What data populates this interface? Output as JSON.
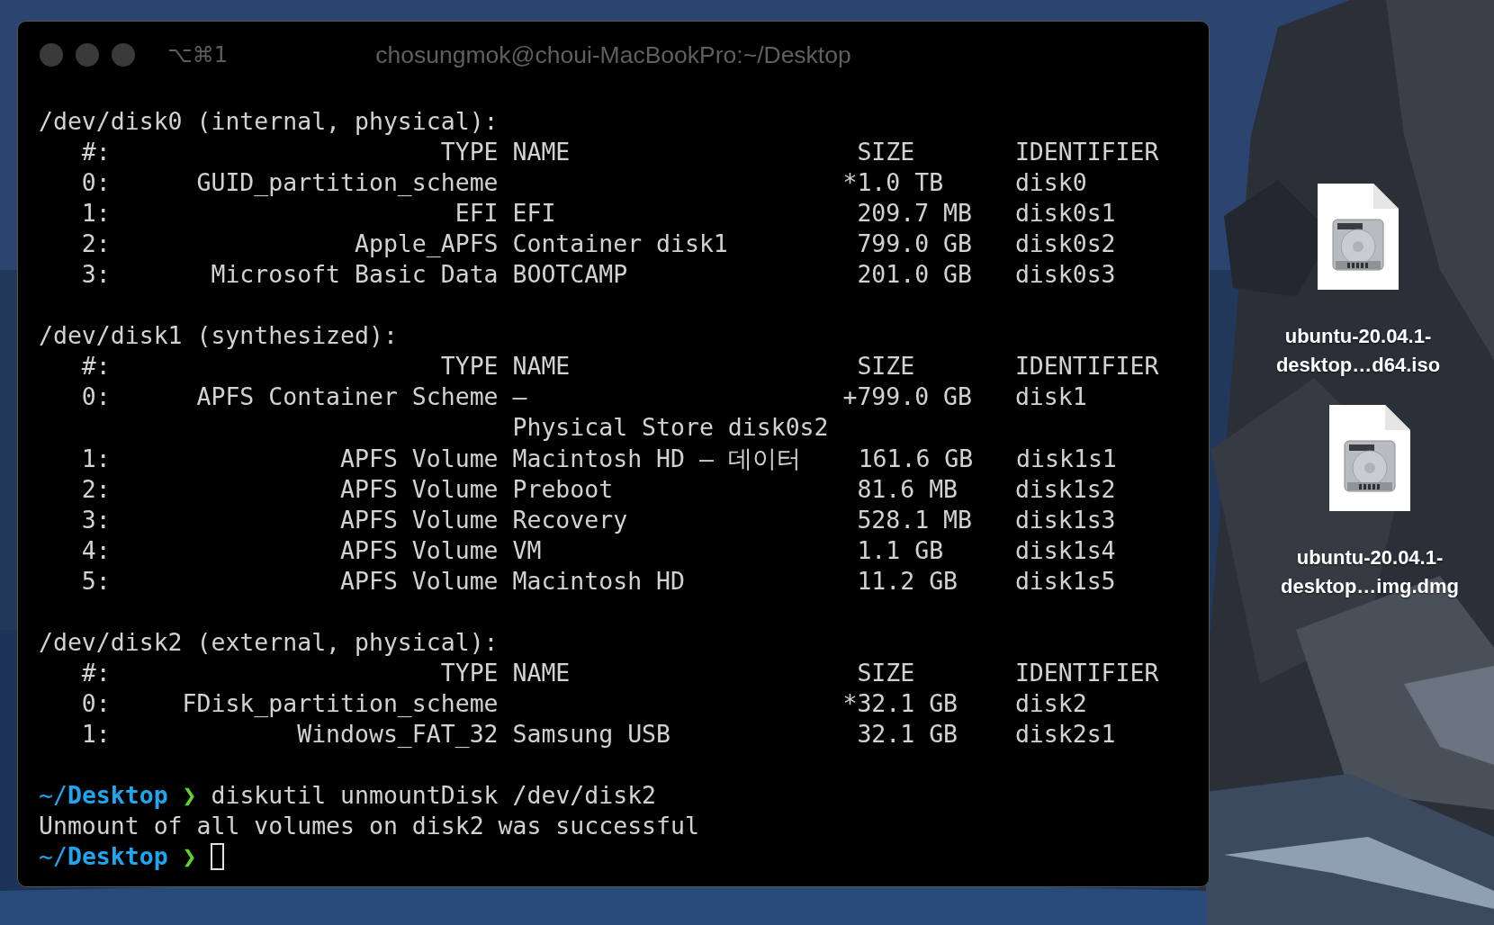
{
  "window": {
    "shortcut": "⌥⌘1",
    "title": "chosungmok@choui-MacBookPro:~/Desktop"
  },
  "terminal": {
    "sections": [
      {
        "lines": [
          {
            "kind": "output",
            "text": "/dev/disk0 (internal, physical):"
          },
          {
            "kind": "output",
            "text": "   #:                       TYPE NAME                    SIZE       IDENTIFIER"
          },
          {
            "kind": "output",
            "text": "   0:      GUID_partition_scheme                        *1.0 TB     disk0"
          },
          {
            "kind": "output",
            "text": "   1:                        EFI EFI                     209.7 MB   disk0s1"
          },
          {
            "kind": "output",
            "text": "   2:                 Apple_APFS Container disk1         799.0 GB   disk0s2"
          },
          {
            "kind": "output",
            "text": "   3:       Microsoft Basic Data BOOTCAMP                201.0 GB   disk0s3"
          }
        ]
      },
      {
        "lines": [
          {
            "kind": "output",
            "text": "/dev/disk1 (synthesized):"
          },
          {
            "kind": "output",
            "text": "   #:                       TYPE NAME                    SIZE       IDENTIFIER"
          },
          {
            "kind": "output",
            "text": "   0:      APFS Container Scheme –                      +799.0 GB   disk1"
          },
          {
            "kind": "output",
            "text": "                                 Physical Store disk0s2"
          },
          {
            "kind": "output",
            "text": "   1:                APFS Volume Macintosh HD – 데이터    161.6 GB   disk1s1"
          },
          {
            "kind": "output",
            "text": "   2:                APFS Volume Preboot                 81.6 MB    disk1s2"
          },
          {
            "kind": "output",
            "text": "   3:                APFS Volume Recovery                528.1 MB   disk1s3"
          },
          {
            "kind": "output",
            "text": "   4:                APFS Volume VM                      1.1 GB     disk1s4"
          },
          {
            "kind": "output",
            "text": "   5:                APFS Volume Macintosh HD            11.2 GB    disk1s5"
          }
        ]
      },
      {
        "lines": [
          {
            "kind": "output",
            "text": "/dev/disk2 (external, physical):"
          },
          {
            "kind": "output",
            "text": "   #:                       TYPE NAME                    SIZE       IDENTIFIER"
          },
          {
            "kind": "output",
            "text": "   0:     FDisk_partition_scheme                        *32.1 GB    disk2"
          },
          {
            "kind": "output",
            "text": "   1:             Windows_FAT_32 Samsung USB             32.1 GB    disk2s1"
          }
        ]
      },
      {
        "lines": [
          {
            "kind": "prompt",
            "path": "~/**Desktop**",
            "symbol": "❯",
            "command": "diskutil unmountDisk /dev/disk2",
            "cursor": false
          },
          {
            "kind": "output",
            "text": "Unmount of all volumes on disk2 was successful"
          },
          {
            "kind": "prompt",
            "path": "~/**Desktop**",
            "symbol": "❯",
            "cursor": true
          }
        ]
      }
    ]
  },
  "desktop": {
    "files": [
      {
        "label": "ubuntu-20.04.1-desktop…d64.iso"
      },
      {
        "label": "ubuntu-20.04.1-desktop…img.dmg"
      }
    ]
  }
}
